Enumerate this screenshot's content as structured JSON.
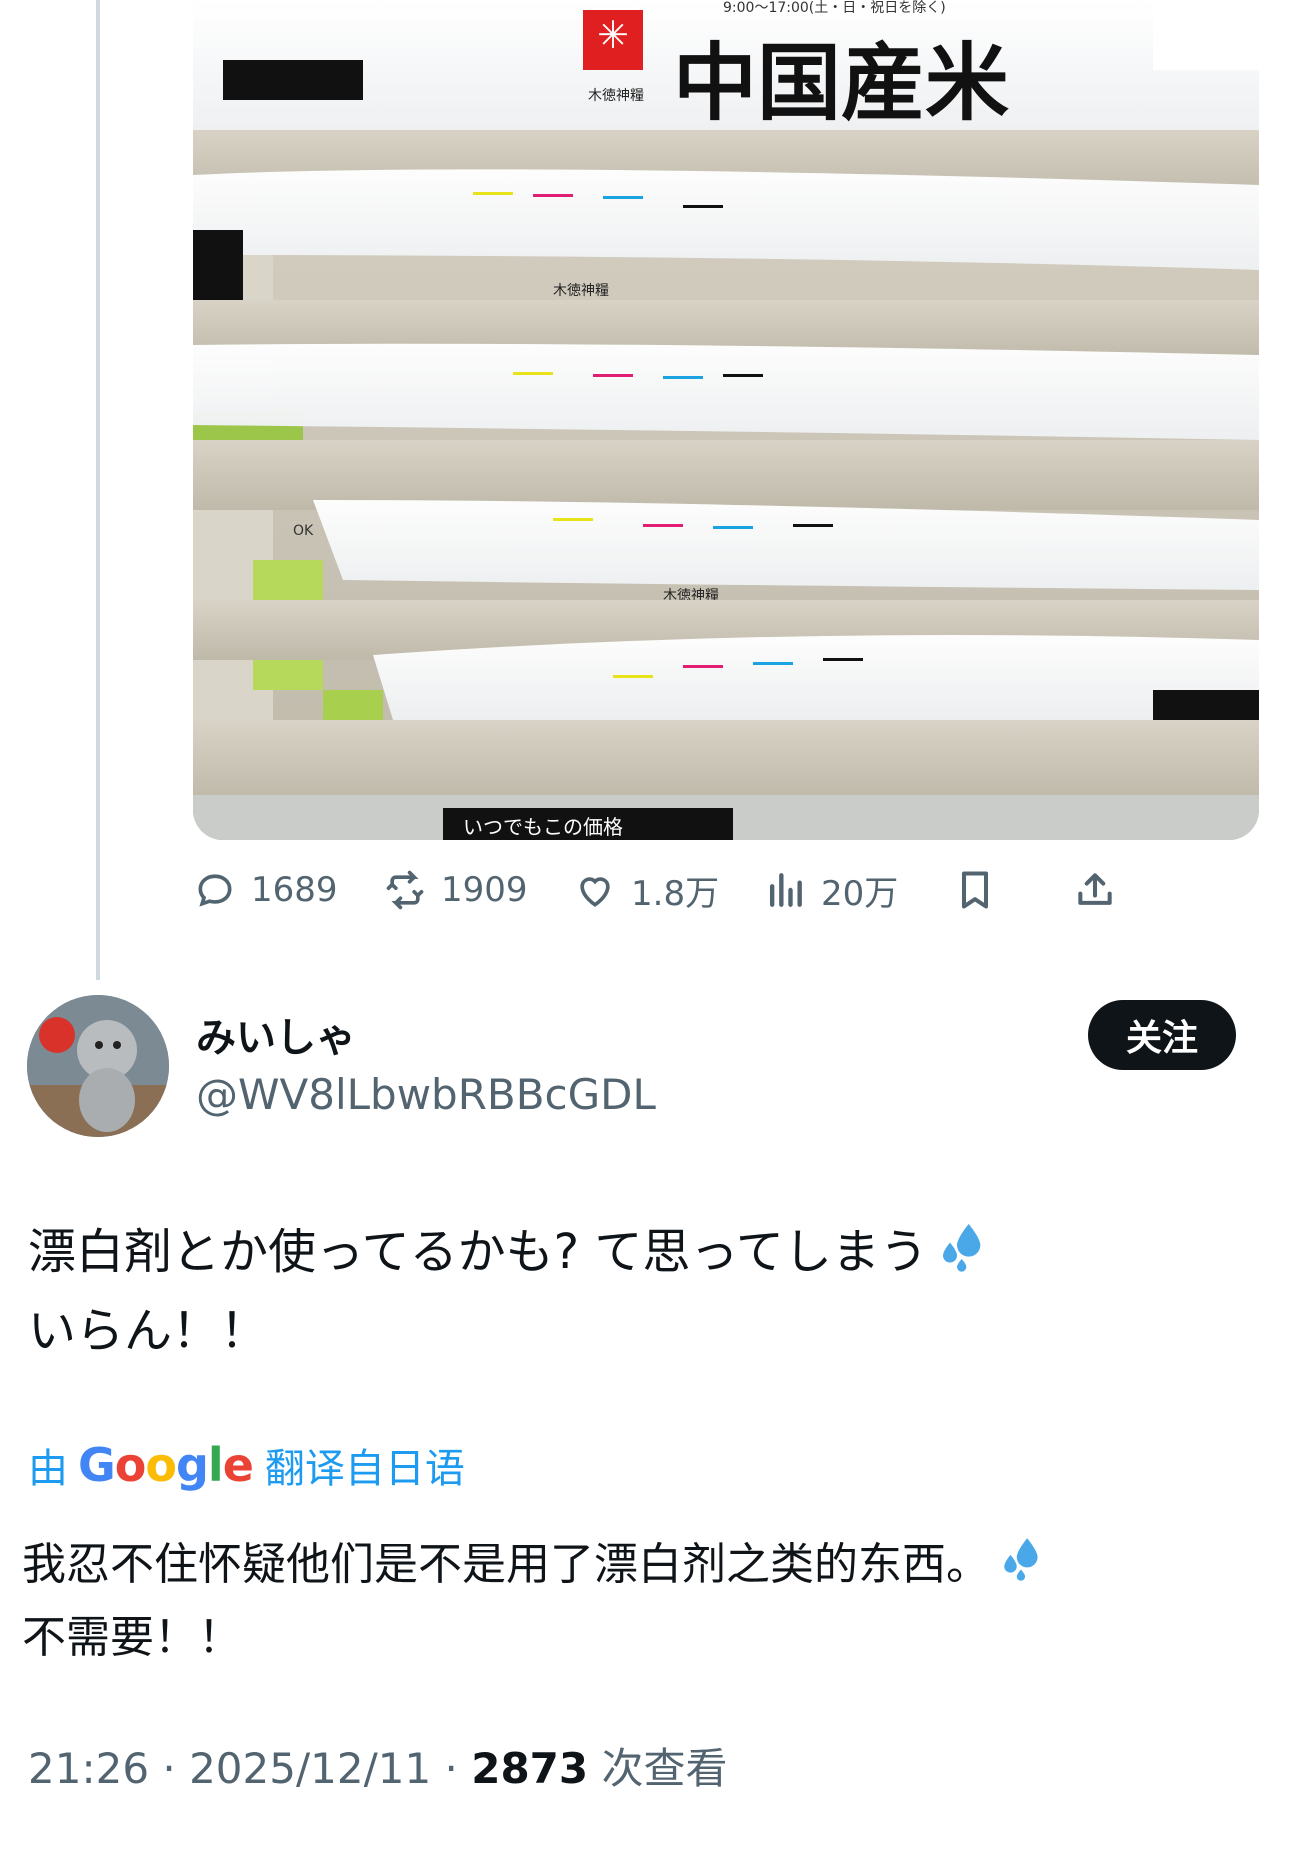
{
  "photo": {
    "header_strip": "9:00〜17:00(土・日・祝日を除く)",
    "product_label": "中国産米",
    "brand": "木徳神糧",
    "price_sign": "いつでもこの価格",
    "shelf_mark": "OK"
  },
  "actions": {
    "replies": "1689",
    "retweets": "1909",
    "likes": "1.8万",
    "views": "20万"
  },
  "user": {
    "name": "みいしゃ",
    "handle": "@WV8lLbwbRBBcGDL",
    "follow_label": "关注"
  },
  "tweet": {
    "line1": "漂白剤とか使ってるかも? て思ってしまう",
    "line2": "いらん！！"
  },
  "translation": {
    "by": "由",
    "google": "Google",
    "label": "翻译自日语",
    "line1": "我忍不住怀疑他们是不是用了漂白剂之类的东西。",
    "line2": "不需要！！"
  },
  "meta": {
    "time": "21:26 · 2025/12/11 · ",
    "view_count": "2873",
    "view_label": " 次查看"
  },
  "colors": {
    "accent": "#1d9bf0",
    "follow_bg": "#0f1419",
    "secondary_text": "#536471",
    "drops": "#4aa8e8"
  }
}
